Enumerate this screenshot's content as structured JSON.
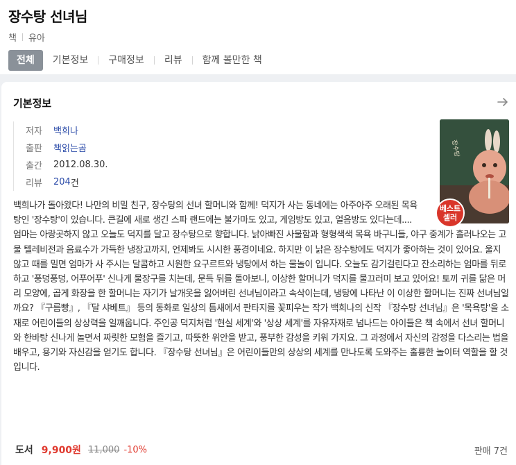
{
  "book": {
    "title": "장수탕 선녀님",
    "category": [
      "책",
      "유아"
    ]
  },
  "tabs": [
    {
      "label": "전체",
      "active": true
    },
    {
      "label": "기본정보",
      "active": false
    },
    {
      "label": "구매정보",
      "active": false
    },
    {
      "label": "리뷰",
      "active": false
    },
    {
      "label": "함께 볼만한 책",
      "active": false
    }
  ],
  "basic_info": {
    "section_title": "기본정보",
    "rows": {
      "author": {
        "label": "저자",
        "value": "백희나"
      },
      "publisher": {
        "label": "출판",
        "value": "책읽는곰"
      },
      "date": {
        "label": "출간",
        "value": "2012.08.30."
      },
      "reviews": {
        "label": "리뷰",
        "value": "204",
        "unit": "건"
      }
    },
    "badge": "베스트셀러",
    "description": "백희나가 돌아왔다! 나만의 비밀 친구, 장수탕의 선녀 할머니와 함께! 덕지가 사는 동네에는 아주아주 오래된 목욕탕인 '장수탕'이 있습니다. 큰길에 새로 생긴 스파 랜드에는 불가마도 있고, 게임방도 있고, 얼음방도 있다는데.... 엄마는 아랑곳하지 않고 오늘도 덕지를 달고 장수탕으로 향합니다. 낡아빠진 사물함과 형형색색 목욕 바구니들, 야구 중계가 흘러나오는 고물 텔레비전과 음료수가 가득한 냉장고까지, 언제봐도 시시한 풍경이네요. 하지만 이 낡은 장수탕에도 덕지가 좋아하는 것이 있어요. 울지 않고 때를 밀면 엄마가 사 주시는 달콤하고 시원한 요구르트와 냉탕에서 하는 물놀이 입니다. 오늘도 감기걸린다고 잔소리하는 엄마를 뒤로하고 '풍덩풍덩, 어푸어푸' 신나게 물장구를 치는데, 문득 뒤를 돌아보니, 이상한 할머니가 덕지를 물끄러미 보고 있어요! 토끼 귀를 닮은 머리 모양에, 곱게 화장을 한 할머니는 자기가 날개옷을 잃어버린 선녀님이라고 속삭이는데, 냉탕에 나타난 이 이상한 할머니는 진짜 선녀님일까요? 『구름빵』, 『달 샤베트』 등의 동화로 일상의 틈새에서 판타지를 꽃피우는 작가 백희나의 신작 『장수탕 선녀님』은 '목욕탕'을 소재로 어린이들의 상상력을 일깨웁니다. 주인공 덕지처럼 '현실 세계'와 '상상 세계'를 자유자재로 넘나드는 아이들은 책 속에서 선녀 할머니와 한바탕 신나게 놀면서 짜릿한 모험을 즐기고, 따뜻한 위안을 받고, 풍부한 감성을 키워 가지요. 그 과정에서 자신의 감정을 다스리는 법을 배우고, 용기와 자신감을 얻기도 합니다. 『장수탕 선녀님』은 어린이들만의 상상의 세계를 만나도록 도와주는 훌륭한 놀이터 역할을 할 것입니다."
  },
  "price": {
    "label": "도서",
    "sale": "9,900원",
    "original": "11,000",
    "discount": "-10%",
    "sold": "판매 7건"
  },
  "colors": {
    "accent_red": "#e03a2f",
    "link_blue": "#2a4aa8",
    "active_tab_bg": "#8a9199"
  }
}
